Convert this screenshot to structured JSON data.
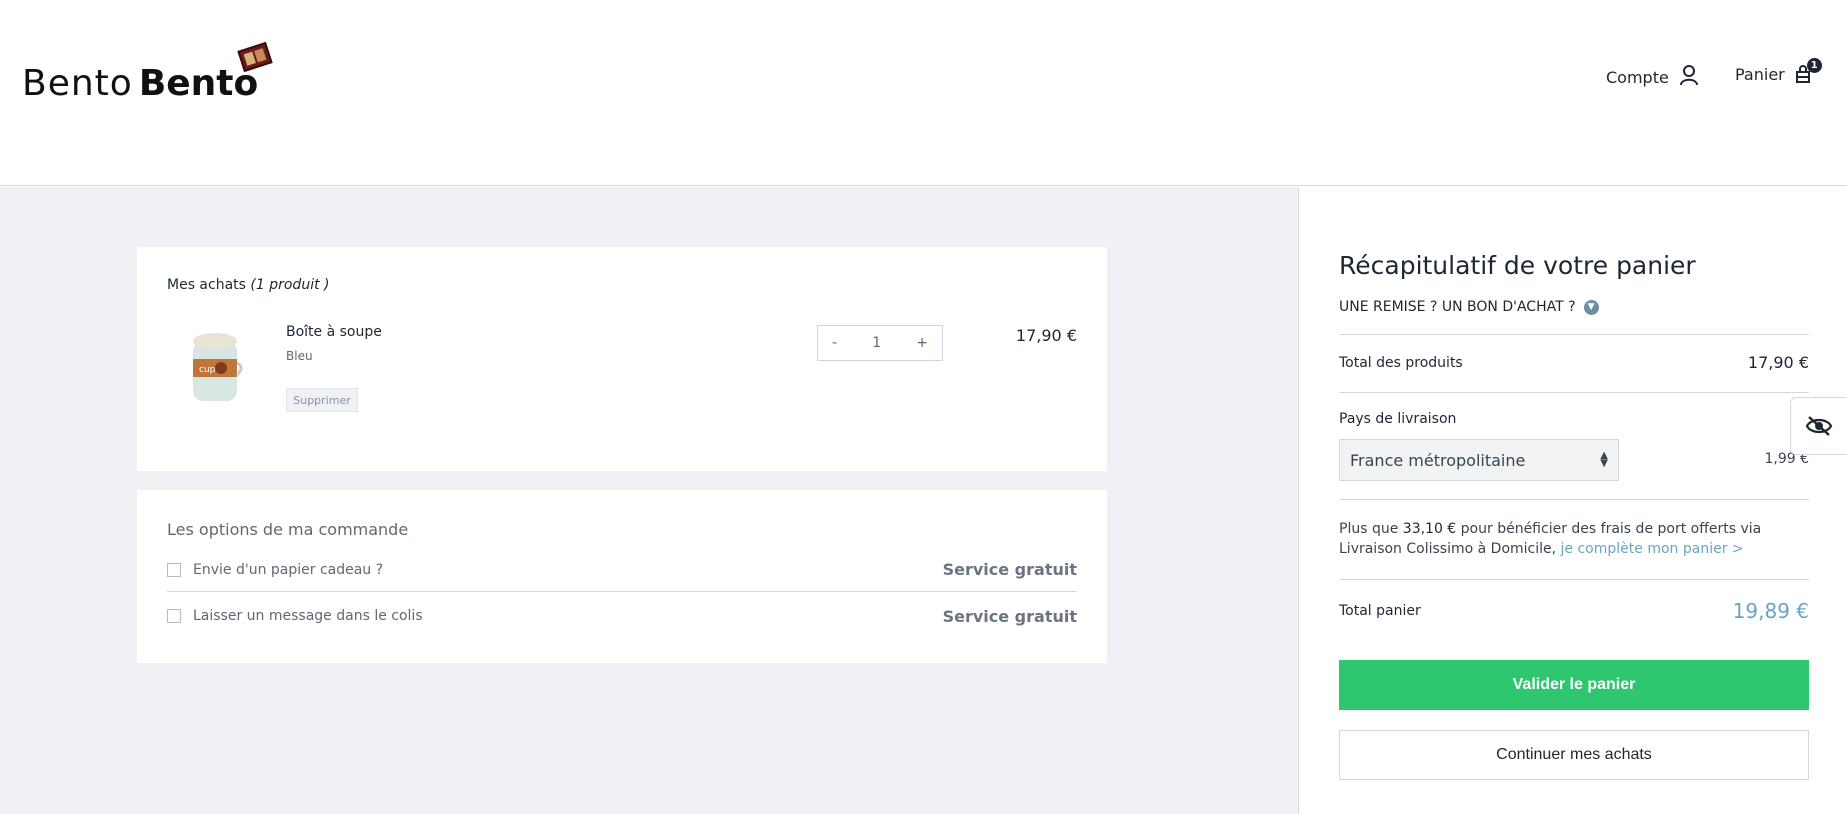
{
  "header": {
    "logo_light": "Bento",
    "logo_bold": "Bento",
    "account_label": "Compte",
    "cart_label": "Panier",
    "cart_count": "1"
  },
  "cart": {
    "title": "Mes achats",
    "count_text": "(1 produit )",
    "items": [
      {
        "name": "Boîte à soupe",
        "variant": "Bleu",
        "remove_label": "Supprimer",
        "minus": "-",
        "quantity": "1",
        "plus": "+",
        "price": "17,90 €"
      }
    ]
  },
  "options": {
    "title": "Les options de ma commande",
    "rows": [
      {
        "label": "Envie d'un papier cadeau ?",
        "price": "Service gratuit"
      },
      {
        "label": "Laisser un message dans le colis",
        "price": "Service gratuit"
      }
    ]
  },
  "summary": {
    "title": "Récapitulatif de votre panier",
    "discount_label": "UNE REMISE ? UN BON D'ACHAT ?",
    "products_total_label": "Total des produits",
    "products_total_value": "17,90 €",
    "country_label": "Pays de livraison",
    "country_value": "France métropolitaine",
    "shipping_value": "1,99 €",
    "free_ship_prefix": "Plus que ",
    "free_ship_amount": "33,10 €",
    "free_ship_text": " pour bénéficier des frais de port offerts via Livraison Colissimo à Domicile, ",
    "free_ship_link": "je complète mon panier >",
    "total_label": "Total panier",
    "total_value": "19,89 €",
    "validate_label": "Valider le panier",
    "continue_label": "Continuer mes achats"
  },
  "colors": {
    "accent_green": "#2ec770",
    "accent_blue": "#6aa5c0",
    "page_bg": "#f0f1f5"
  },
  "icons": [
    "user-icon",
    "bag-icon",
    "chevron-down-icon",
    "updown-icon",
    "eye-slash-icon"
  ]
}
